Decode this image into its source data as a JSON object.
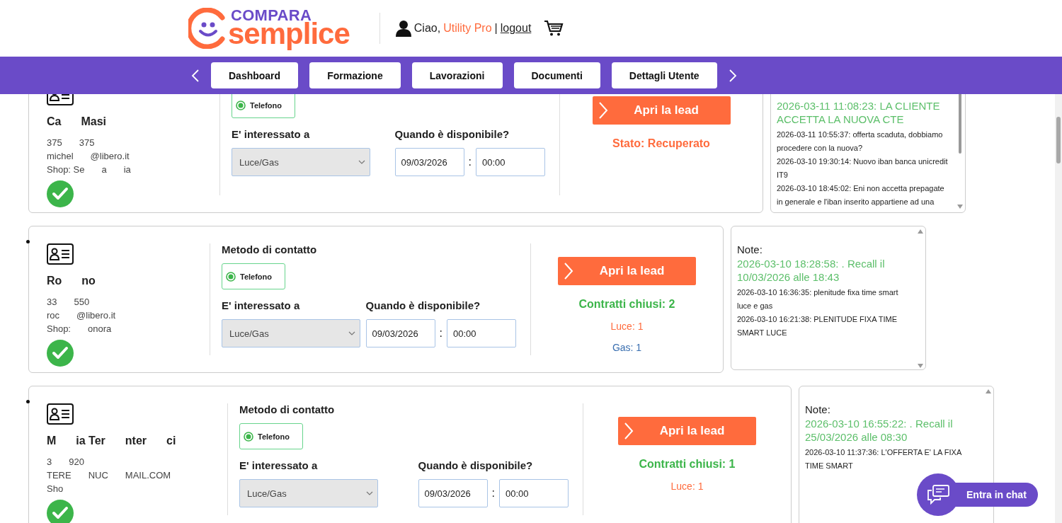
{
  "header": {
    "logo_top": "COMPARA",
    "logo_bottom": "semplice",
    "greeting": "Ciao,",
    "user": "Utility Pro",
    "separator": "|",
    "logout": "logout"
  },
  "nav": {
    "tabs": [
      {
        "label": "Dashboard",
        "selected": false
      },
      {
        "label": "Formazione",
        "selected": false
      },
      {
        "label": "Lavorazioni",
        "selected": false
      },
      {
        "label": "Documenti",
        "selected": false
      },
      {
        "label": "Dettagli Utente",
        "selected": false
      }
    ]
  },
  "leads": [
    {
      "name_parts": [
        "Ca",
        "Masi"
      ],
      "phone_parts": [
        "375",
        "375"
      ],
      "email_parts": [
        "michel",
        "@libero.it"
      ],
      "shop_parts": [
        "Shop: Se",
        "a",
        "ia"
      ],
      "contact_option": {
        "label": "Telefono",
        "selected": true
      },
      "interest_label": "E' interessato a",
      "interest_value": "Luce/Gas",
      "availability_label": "Quando è disponibile?",
      "date": "09/03/2026",
      "colon": ":",
      "time": "00:00",
      "action": "Apri la lead",
      "summary": [
        {
          "text": "Stato: Recuperato",
          "kind": "heading",
          "color": "#ff6b3d"
        }
      ],
      "notes": [
        {
          "text": "2026-03-11 11:08:23: LA CLIENTE ACCETTA LA NUOVA CTE",
          "kind": "recall"
        },
        {
          "text": "2026-03-11 10:55:37: offerta scaduta, dobbiamo procedere con la nuova?",
          "kind": "entry"
        },
        {
          "text": "2026-03-10 19:30:14: Nuovo iban banca unicredit IT9",
          "kind": "entry"
        },
        {
          "text": "2026-03-10 18:45:02: Eni non accetta prepagate in generale e l'iban inserito appartiene ad una",
          "kind": "entry"
        }
      ]
    },
    {
      "name_parts": [
        "Ro",
        "no"
      ],
      "phone_parts": [
        "33",
        "550"
      ],
      "email_parts": [
        "roc",
        "@libero.it"
      ],
      "shop_parts": [
        "Shop:",
        "onora"
      ],
      "contact_title": "Metodo di contatto",
      "contact_option": {
        "label": "Telefono",
        "selected": true
      },
      "interest_label": "E' interessato a",
      "interest_value": "Luce/Gas",
      "availability_label": "Quando è disponibile?",
      "date": "09/03/2026",
      "colon": ":",
      "time": "00:00",
      "action": "Apri la lead",
      "summary": [
        {
          "text": "Contratti chiusi: 2",
          "kind": "heading",
          "color": "#3cb54a"
        },
        {
          "text": "Luce: 1",
          "kind": "detail",
          "color": "#ff6b3d"
        },
        {
          "text": "Gas: 1",
          "kind": "detail",
          "color": "#3a6fb0"
        }
      ],
      "notes_label": "Note:",
      "notes": [
        {
          "text": "2026-03-10 18:28:58: . Recall il 10/03/2026 alle 18:43",
          "kind": "recall"
        },
        {
          "text": "2026-03-10 16:36:35: plenitude fixa time smart luce e gas",
          "kind": "entry"
        },
        {
          "text": "2026-03-10 16:21:38: PLENITUDE FIXA TIME SMART LUCE",
          "kind": "entry"
        }
      ]
    },
    {
      "name_parts": [
        "M",
        "ia Ter",
        "nter",
        "ci"
      ],
      "phone_parts": [
        "3",
        "920"
      ],
      "email_parts": [
        "TERE",
        "NUC",
        "MAIL.COM"
      ],
      "shop_parts": [
        "Sho"
      ],
      "contact_title": "Metodo di contatto",
      "contact_option": {
        "label": "Telefono",
        "selected": true
      },
      "interest_label": "E' interessato a",
      "interest_value": "Luce/Gas",
      "availability_label": "Quando è disponibile?",
      "date": "09/03/2026",
      "colon": ":",
      "time": "00:00",
      "action": "Apri la lead",
      "summary": [
        {
          "text": "Contratti chiusi: 1",
          "kind": "heading",
          "color": "#3cb54a"
        },
        {
          "text": "Luce: 1",
          "kind": "detail",
          "color": "#ff6b3d"
        }
      ],
      "notes_label": "Note:",
      "notes": [
        {
          "text": "2026-03-10 16:55:22: . Recall il 25/03/2026 alle 08:30",
          "kind": "recall"
        },
        {
          "text": "2026-03-10 11:37:36: L'OFFERTA E' LA FIXA TIME SMART",
          "kind": "entry"
        }
      ]
    }
  ],
  "chat": {
    "label": "Entra in chat"
  }
}
